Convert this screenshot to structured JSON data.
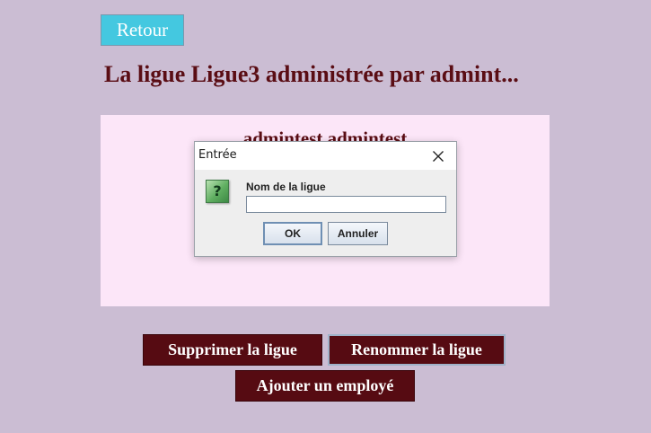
{
  "header": {
    "back_label": "Retour",
    "title": "La ligue Ligue3 administrée par  admint..."
  },
  "panel": {
    "admin_name": "admintest  admintest"
  },
  "actions": {
    "delete_label": "Supprimer la ligue",
    "rename_label": "Renommer la ligue",
    "add_employee_label": "Ajouter un employé"
  },
  "dialog": {
    "title": "Entrée",
    "icon": "question-icon",
    "icon_glyph": "?",
    "field_label": "Nom de la ligue",
    "field_value": "",
    "ok_label": "OK",
    "cancel_label": "Annuler"
  },
  "colors": {
    "background": "#cbbdd3",
    "back_button": "#44c8e0",
    "title_text": "#5a0d14",
    "panel": "#fce6f8",
    "action_button": "#560b12"
  }
}
